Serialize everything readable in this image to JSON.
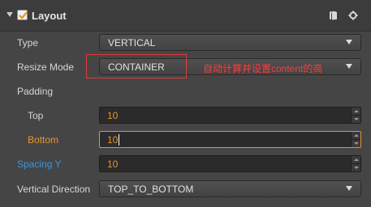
{
  "header": {
    "title": "Layout",
    "enabled": true
  },
  "fields": {
    "type": {
      "label": "Type",
      "value": "VERTICAL"
    },
    "resize_mode": {
      "label": "Resize Mode",
      "value": "CONTAINER"
    },
    "padding": {
      "label": "Padding"
    },
    "top": {
      "label": "Top",
      "value": "10"
    },
    "bottom": {
      "label": "Bottom",
      "value": "10"
    },
    "spacing_y": {
      "label": "Spacing Y",
      "value": "10"
    },
    "vertical_direction": {
      "label": "Vertical Direction",
      "value": "TOP_TO_BOTTOM"
    }
  },
  "annotation": {
    "text": "自动计算并设置content的高",
    "color": "#ff3b3b"
  },
  "colors": {
    "orange_accent": "#e8942a",
    "blue_accent": "#3c96dc"
  },
  "icons": [
    "collapse-arrow-icon",
    "checkbox-checked-icon",
    "book-icon",
    "gear-icon"
  ]
}
